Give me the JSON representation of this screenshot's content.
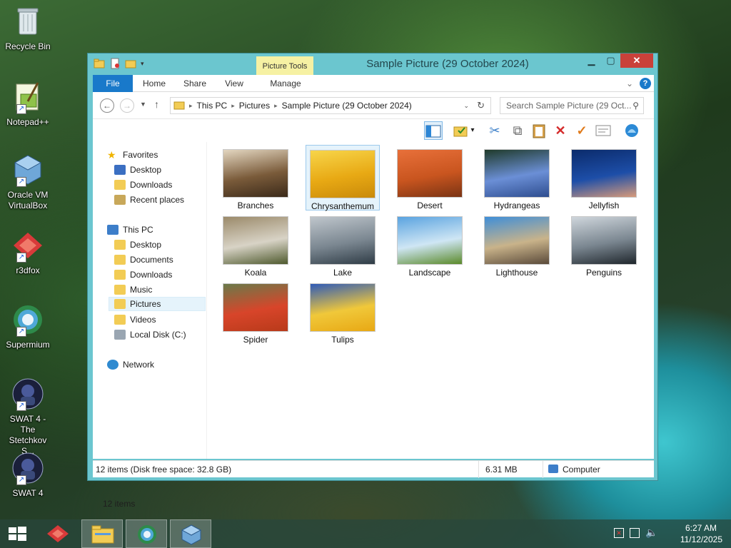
{
  "desktop": {
    "icons": [
      {
        "label": "Recycle Bin",
        "icon": "recycle-bin-icon"
      },
      {
        "label": "Notepad++",
        "icon": "notepad-plus-plus-icon"
      },
      {
        "label": "Oracle VM VirtualBox",
        "icon": "virtualbox-icon"
      },
      {
        "label": "r3dfox",
        "icon": "r3dfox-icon"
      },
      {
        "label": "Supermium",
        "icon": "supermium-icon"
      },
      {
        "label": "SWAT 4 - The Stetchkov S...",
        "icon": "swat4-expansion-icon"
      },
      {
        "label": "SWAT 4",
        "icon": "swat4-icon"
      }
    ]
  },
  "window": {
    "title": "Sample Picture (29 October 2024)",
    "context_tab": "Picture Tools",
    "ribbon_tabs": [
      "File",
      "Home",
      "Share",
      "View",
      "Manage"
    ],
    "breadcrumb": [
      "This PC",
      "Pictures",
      "Sample Picture (29 October 2024)"
    ],
    "search_placeholder": "Search Sample Picture (29 Oct...",
    "nav": {
      "favorites_label": "Favorites",
      "favorites": [
        "Desktop",
        "Downloads",
        "Recent places"
      ],
      "thispc_label": "This PC",
      "thispc": [
        "Desktop",
        "Documents",
        "Downloads",
        "Music",
        "Pictures",
        "Videos",
        "Local Disk (C:)"
      ],
      "network_label": "Network",
      "selected": "Pictures"
    },
    "files": [
      {
        "name": "Branches",
        "colors": [
          "#e3d6c0",
          "#7a5b3a",
          "#3b2a1a"
        ]
      },
      {
        "name": "Chrysanthemum",
        "colors": [
          "#f7d54a",
          "#e8a914",
          "#c98a0a"
        ],
        "selected": true
      },
      {
        "name": "Desert",
        "colors": [
          "#e8703a",
          "#c9551f",
          "#7a3414"
        ]
      },
      {
        "name": "Hydrangeas",
        "colors": [
          "#1f3a2a",
          "#6b8fd6",
          "#2e4d8f"
        ]
      },
      {
        "name": "Jellyfish",
        "colors": [
          "#0b2b6b",
          "#1d4ea8",
          "#d79a7a"
        ]
      },
      {
        "name": "Koala",
        "colors": [
          "#9b8a6a",
          "#d8d3c6",
          "#4f5a2e"
        ]
      },
      {
        "name": "Lake",
        "colors": [
          "#bfc6cc",
          "#7b8791",
          "#2f3c46"
        ]
      },
      {
        "name": "Landscape",
        "colors": [
          "#5aa3e0",
          "#cfe6f4",
          "#5b8a2a"
        ]
      },
      {
        "name": "Lighthouse",
        "colors": [
          "#3f8ed8",
          "#c9b38a",
          "#5a4a3a"
        ]
      },
      {
        "name": "Penguins",
        "colors": [
          "#cfd6dc",
          "#7a8690",
          "#1f262c"
        ]
      },
      {
        "name": "Spider",
        "colors": [
          "#6a7a4a",
          "#d8452a",
          "#b83a1a"
        ]
      },
      {
        "name": "Tulips",
        "colors": [
          "#2f5bb8",
          "#f0c83a",
          "#e8a814"
        ]
      }
    ],
    "item_count": "12 items",
    "status": {
      "summary": "12 items (Disk free space: 32.8 GB)",
      "size": "6.31 MB",
      "location": "Computer"
    }
  },
  "taskbar": {
    "time": "6:27 AM",
    "date": "11/12/2025",
    "apps": [
      "r3dfox-icon",
      "file-explorer-icon",
      "supermium-icon",
      "virtualbox-icon"
    ]
  }
}
